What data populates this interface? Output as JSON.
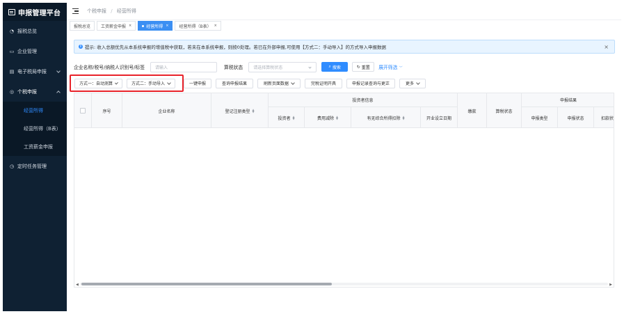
{
  "app": {
    "title": "申报管理平台"
  },
  "sidebar": {
    "items": [
      {
        "label": "报税总览",
        "icon": "dashboard-icon"
      },
      {
        "label": "企业管理",
        "icon": "monitor-icon"
      },
      {
        "label": "电子税局申报",
        "icon": "bank-icon"
      },
      {
        "label": "个税申报",
        "icon": "user-icon"
      }
    ],
    "sub_items": [
      {
        "label": "经营所得",
        "active": true
      },
      {
        "label": "经营所得（B表）",
        "active": false
      },
      {
        "label": "工资薪金申报",
        "active": false
      }
    ],
    "bottom_item": {
      "label": "定时任务管理",
      "icon": "clock-icon"
    }
  },
  "breadcrumb": {
    "level1": "个税申报",
    "separator": "/",
    "level2": "经营所得"
  },
  "tabs": [
    {
      "label": "报税总览",
      "active": false,
      "closable": false
    },
    {
      "label": "工资薪金申报",
      "active": false,
      "closable": true
    },
    {
      "label": "经营所得",
      "active": true,
      "closable": true
    },
    {
      "label": "经营所得（B表）",
      "active": false,
      "closable": true
    }
  ],
  "alert": {
    "text": "提示: 收入总额优先从本系统申报的增值税中获取，若未在本系统申报，则按0处理。若已在外部申报,可使用【方式二：手动导入】的方式导入申报数据"
  },
  "filter": {
    "company_label": "企业名称/税号/纳税人识别号/标签",
    "company_placeholder": "请输入",
    "status_label": "算税状态",
    "status_placeholder": "请选择算税状态",
    "search_label": "搜索",
    "reset_label": "重置",
    "expand_label": "展开筛选"
  },
  "actions": [
    {
      "label": "方式一：自动测算",
      "dropdown": true
    },
    {
      "label": "方式二：手动导入",
      "dropdown": true
    },
    {
      "label": "一键申报",
      "dropdown": false
    },
    {
      "label": "查询申报结果",
      "dropdown": false
    },
    {
      "label": "刷新页面数据",
      "dropdown": true
    },
    {
      "label": "完税证明开具",
      "dropdown": false
    },
    {
      "label": "申报记录查询与更正",
      "dropdown": false
    },
    {
      "label": "更多",
      "dropdown": true
    }
  ],
  "table": {
    "headers": {
      "index": "序号",
      "company": "企业名称",
      "reg_type": "登记注册类型",
      "investor_group": "投资者信息",
      "investor": "投资者",
      "deduction": "费用减除",
      "comprehensive": "有无综合所得扣除",
      "open_date": "开业设立日期",
      "payment": "缴款",
      "calc_status": "算税状态",
      "result_group": "申报结果",
      "decl_type": "申报类型",
      "decl_status": "申报状态",
      "debit_status": "扣款状"
    },
    "rows": []
  },
  "colors": {
    "sidebar_bg": "#0f2133",
    "accent": "#2f8cff",
    "highlight_border": "#e8222a",
    "alert_bg": "#e8f4ff"
  }
}
